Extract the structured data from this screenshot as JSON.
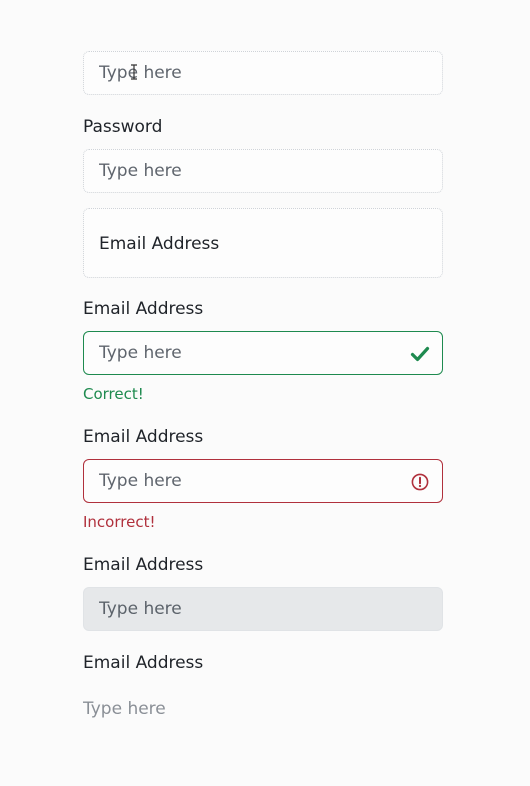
{
  "fields": [
    {
      "label": "",
      "placeholder": "Type here"
    },
    {
      "label": "Password",
      "placeholder": "Type here"
    },
    {
      "floating_label": "Email Address"
    },
    {
      "label": "Email Address",
      "placeholder": "Type here",
      "state": "valid",
      "feedback": "Correct!"
    },
    {
      "label": "Email Address",
      "placeholder": "Type here",
      "state": "invalid",
      "feedback": "Incorrect!"
    },
    {
      "label": "Email Address",
      "placeholder": "Type here",
      "state": "disabled"
    },
    {
      "label": "Email Address",
      "placeholder": "Type here",
      "state": "plaintext"
    }
  ],
  "colors": {
    "valid": "#1e8a4f",
    "invalid": "#b0303c",
    "disabled_bg": "#e6e8ea"
  },
  "icons": {
    "valid": "check-icon",
    "invalid": "exclamation-circle-icon",
    "cursor": "text-cursor-icon"
  }
}
